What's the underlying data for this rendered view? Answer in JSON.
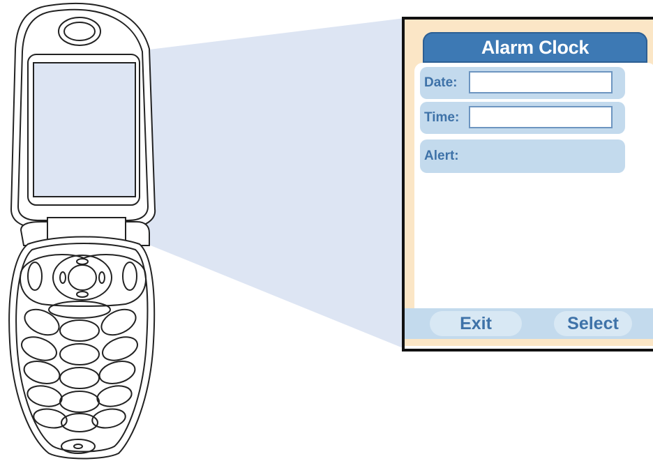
{
  "screen": {
    "title": "Alarm Clock",
    "fields": [
      {
        "label": "Date:",
        "value": ""
      },
      {
        "label": "Time:",
        "value": ""
      },
      {
        "label": "Alert:"
      }
    ],
    "softkeys": {
      "left": "Exit",
      "right": "Select"
    }
  },
  "colors": {
    "title_bar": "#3d79b4",
    "field_background": "#c3daed",
    "label_text": "#3e72a8",
    "frame_background": "#fbe6c6",
    "projection": "#dde5f3"
  },
  "icons": [
    "flip-phone-illustration"
  ]
}
